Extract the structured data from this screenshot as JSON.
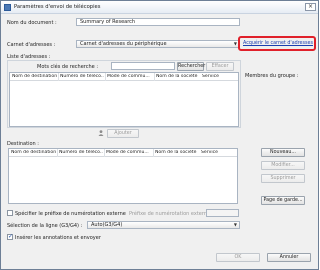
{
  "window": {
    "title": "Paramètres d'envoi de télécopies",
    "close_glyph": "×"
  },
  "document_name": {
    "label": "Nom du document :",
    "value": "Summary of Research"
  },
  "address_book": {
    "label": "Carnet d'adresses :",
    "value": "Carnet d'adresses du périphérique",
    "acquire_link": "Acquérir le carnet d'adresses"
  },
  "address_list": {
    "label": "Liste d'adresses :",
    "search_label": "Mots clés de recherche :",
    "search_value": "",
    "search_button": "Rechercher",
    "clear_button": "Effacer",
    "columns": [
      "Nom de destination",
      "Numéro de téléco...",
      "Mode de commu...",
      "Nom de la société",
      "Service"
    ]
  },
  "group_members_label": "Membres du groupe :",
  "add_button": "Ajouter",
  "destination": {
    "label": "Destination :",
    "columns": [
      "Nom de destination",
      "Numéro de téléco...",
      "Mode de commu...",
      "Nom de la société",
      "Service"
    ],
    "new_button": "Nouveau...",
    "edit_button": "Modifier...",
    "delete_button": "Supprimer",
    "cover_page_button": "Page de garde..."
  },
  "prefix": {
    "checkbox_label": "Spécifier le préfixe de numérotation externe",
    "checked": false,
    "field_label": "Préfixe de numérotation externe :",
    "value": ""
  },
  "line": {
    "label": "Sélection de la ligne (G3/G4) :",
    "value": "Auto(G3/G4)"
  },
  "annotations": {
    "label": "Insérer les annotations et envoyer",
    "checked": true
  },
  "footer": {
    "ok_button": "OK",
    "cancel_button": "Annuler"
  },
  "colors": {
    "highlight": "#e0202a",
    "link": "#1a3fb0"
  }
}
